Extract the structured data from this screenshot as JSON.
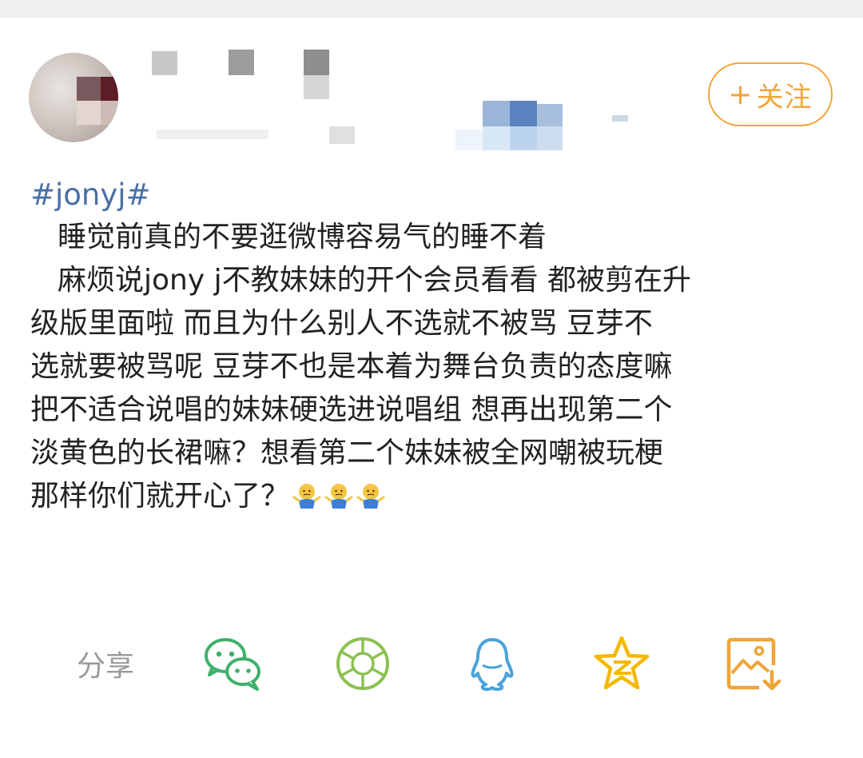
{
  "header": {
    "follow_label": "关注",
    "follow_plus": "+"
  },
  "post": {
    "hashtag": "#jonyj#",
    "lines": [
      "睡觉前真的不要逛微博容易气的睡不着",
      "麻烦说jony j不教妹妹的开个会员看看 都被剪在升",
      "级版里面啦 而且为什么别人不选就不被骂 豆芽不",
      "选就要被骂呢 豆芽不也是本着为舞台负责的态度嘛",
      "把不适合说唱的妹妹硬选进说唱组 想再出现第二个",
      "淡黄色的长裙嘛？想看第二个妹妹被全网嘲被玩梗",
      "那样你们就开心了？"
    ],
    "emoji": [
      "shrug-emoji",
      "shrug-emoji",
      "shrug-emoji"
    ]
  },
  "share": {
    "label": "分享",
    "icons": [
      "wechat-icon",
      "moments-icon",
      "qq-icon",
      "qzone-icon",
      "save-image-icon"
    ]
  },
  "colors": {
    "accent": "#f0a53a",
    "hashtag": "#4a6fa5",
    "wechat": "#3fb06b",
    "moments": "#8cc152",
    "qq": "#4aa3d8",
    "qzone": "#f5b800",
    "save": "#f0a53a"
  }
}
